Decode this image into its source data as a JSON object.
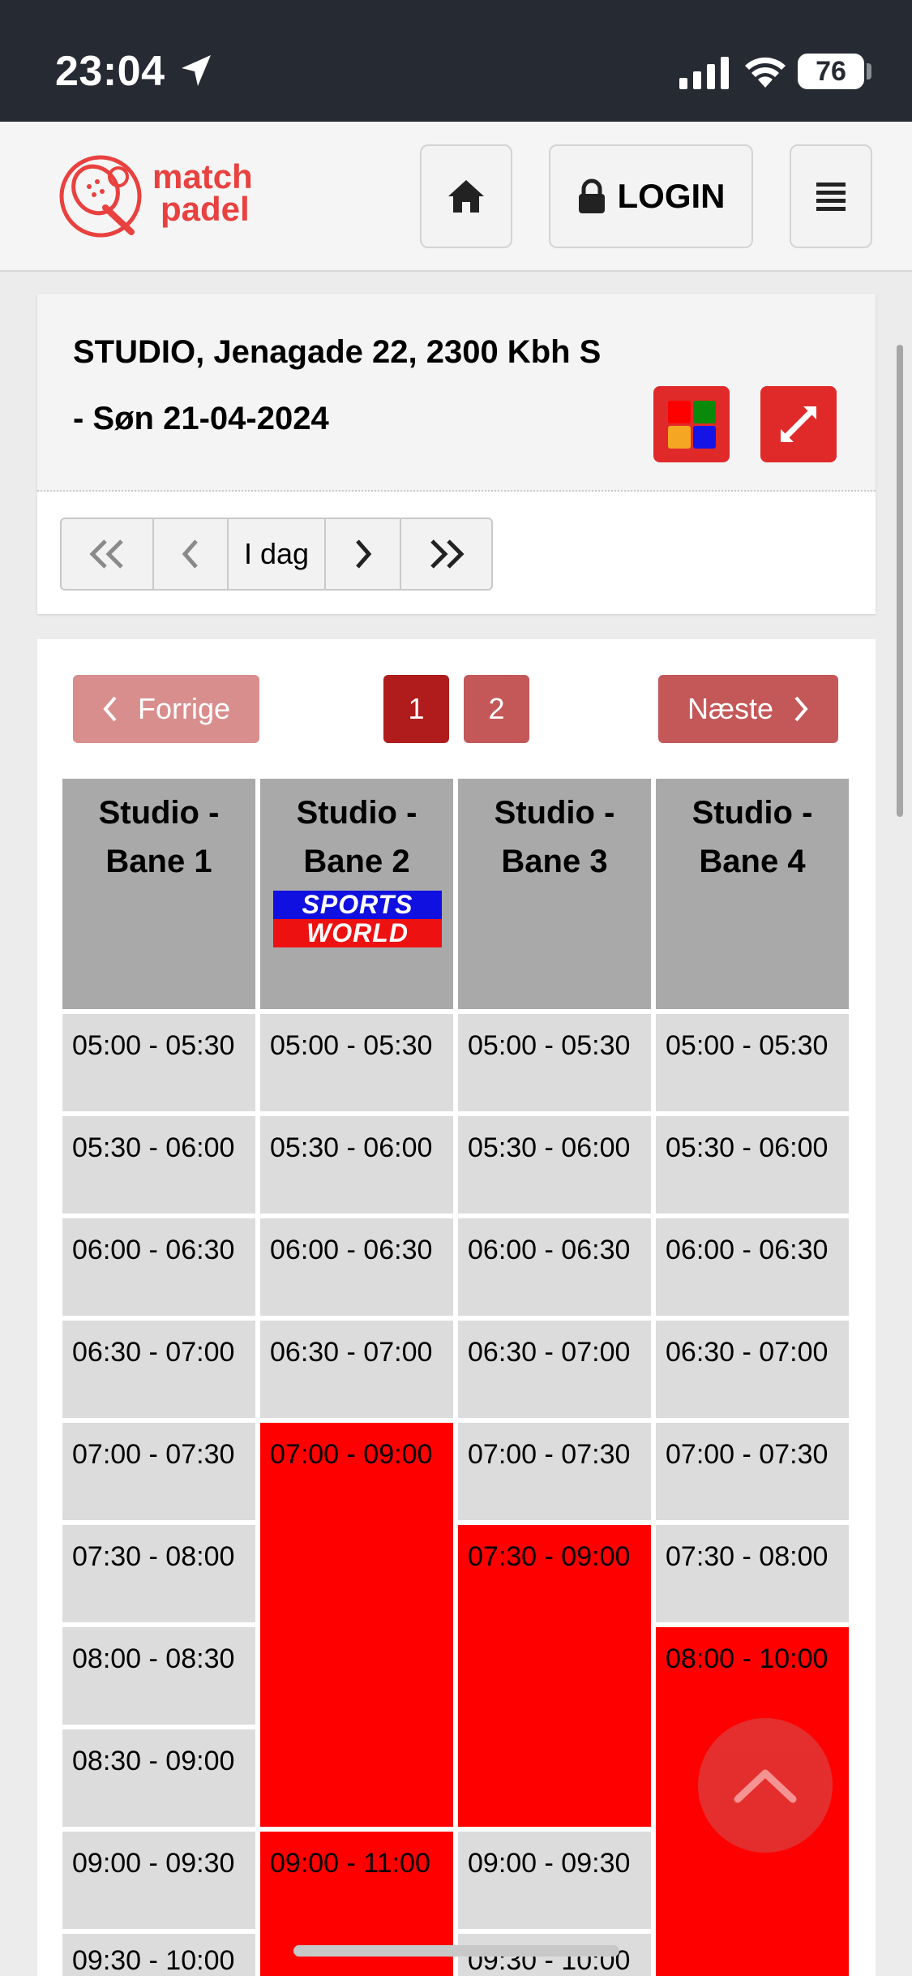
{
  "status_bar": {
    "time": "23:04",
    "battery": "76"
  },
  "header": {
    "logo_line1": "match",
    "logo_line2": "padel",
    "login_label": "LOGIN"
  },
  "venue": {
    "line1": "STUDIO, Jenagade 22, 2300 Kbh S",
    "line2": "- Søn 21-04-2024"
  },
  "date_nav": {
    "today_label": "I dag"
  },
  "pagination": {
    "prev_label": "Forrige",
    "next_label": "Næste",
    "pages": [
      "1",
      "2"
    ],
    "active_page": "1"
  },
  "courts": [
    {
      "line1": "Studio -",
      "line2": "Bane 1"
    },
    {
      "line1": "Studio -",
      "line2": "Bane 2",
      "sponsor_top": "SPORTS",
      "sponsor_bottom": "WORLD"
    },
    {
      "line1": "Studio -",
      "line2": "Bane 3"
    },
    {
      "line1": "Studio -",
      "line2": "Bane 4"
    }
  ],
  "slots": {
    "court1": [
      "05:00 - 05:30",
      "05:30 - 06:00",
      "06:00 - 06:30",
      "06:30 - 07:00",
      "07:00 - 07:30",
      "07:30 - 08:00",
      "08:00 - 08:30",
      "08:30 - 09:00",
      "09:00 - 09:30",
      "09:30 - 10:00"
    ],
    "court2": [
      "05:00 - 05:30",
      "05:30 - 06:00",
      "06:00 - 06:30",
      "06:30 - 07:00",
      "07:00 - 09:00",
      "09:00 - 11:00"
    ],
    "court3": [
      "05:00 - 05:30",
      "05:30 - 06:00",
      "06:00 - 06:30",
      "06:30 - 07:00",
      "07:00 - 07:30",
      "07:30 - 09:00",
      "09:00 - 09:30",
      "09:30 - 10:00"
    ],
    "court4": [
      "05:00 - 05:30",
      "05:30 - 06:00",
      "06:00 - 06:30",
      "06:30 - 07:00",
      "07:00 - 07:30",
      "07:30 - 08:00",
      "08:00 - 10:00"
    ]
  },
  "colors": {
    "brand": "#e8413f",
    "booked": "#ff0000",
    "free": "#dcdcdc",
    "header_gray": "#a9a9a9"
  }
}
